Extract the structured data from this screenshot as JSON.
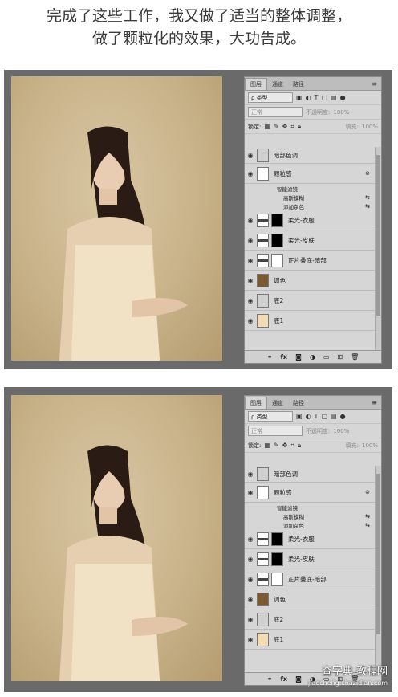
{
  "caption": {
    "line1": "完成了这些工作，我又做了适当的整体调整，",
    "line2": "做了颗粒化的效果，大功告成。"
  },
  "panel": {
    "tabs": [
      "图层",
      "通道",
      "路径"
    ],
    "kind": "ρ 类型",
    "blend": "正常",
    "opacity_label": "不透明度:",
    "opacity_value": "100%",
    "lock_label": "锁定:",
    "fill_label": "填充:",
    "fill_value": "100%",
    "layers": [
      {
        "name": "暗部色调",
        "thumb": "grey"
      },
      {
        "name": "颗粒感",
        "thumb": "white",
        "smart": true
      },
      {
        "name": "柔光-衣服",
        "thumb": "portrait",
        "mask": "blackmask"
      },
      {
        "name": "柔光-皮肤",
        "thumb": "portrait",
        "mask": "blackmask"
      },
      {
        "name": "正片叠底-暗部",
        "thumb": "portrait",
        "mask": "white"
      },
      {
        "name": "调色",
        "thumb": "brown"
      },
      {
        "name": "底2",
        "thumb": "grey"
      },
      {
        "name": "底1",
        "thumb": "beige"
      }
    ],
    "smart_filters": "智能滤镜",
    "filter1": "高斯模糊",
    "filter2": "添加杂色",
    "footer_icons": [
      "link-icon",
      "fx-icon",
      "mask-icon",
      "adjustment-icon",
      "folder-icon",
      "new-layer-icon",
      "trash-icon"
    ]
  },
  "watermark": {
    "main": "查字典 教程网",
    "url": "jiaocheng.chazidian.com"
  }
}
